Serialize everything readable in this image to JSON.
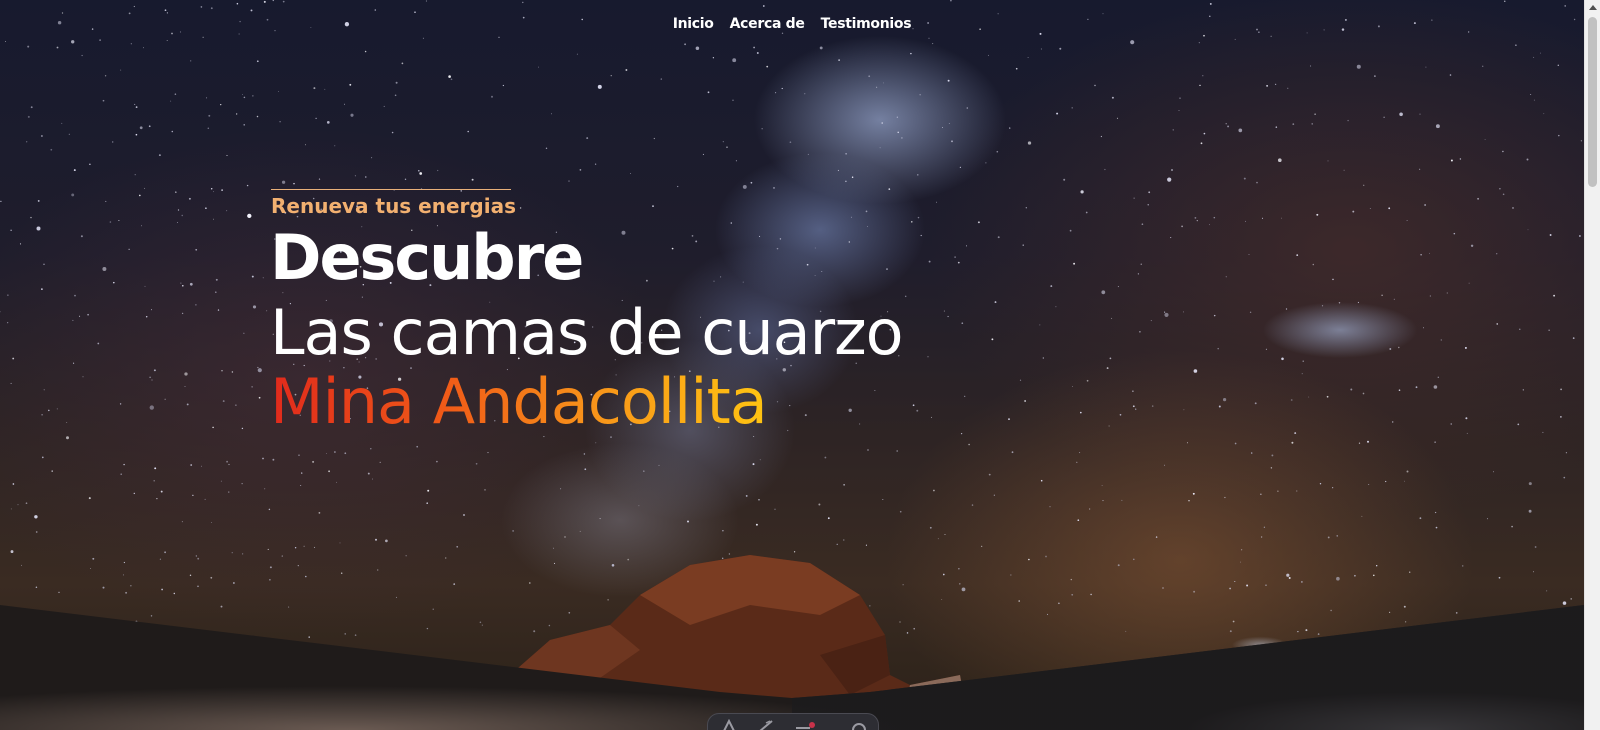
{
  "nav": {
    "items": [
      {
        "label": "Inicio"
      },
      {
        "label": "Acerca de"
      },
      {
        "label": "Testimonios"
      }
    ]
  },
  "hero": {
    "tagline": "Renueva tus energias",
    "title_line1": "Descubre",
    "title_line2": "Las camas de cuarzo",
    "title_line3": "Mina Andacollita"
  },
  "colors": {
    "tagline": "#f2b070",
    "title": "#ffffff",
    "gradient_start": "#e02a1c",
    "gradient_end": "#ffc412"
  },
  "dock": {
    "items": [
      {
        "icon": "text-icon"
      },
      {
        "icon": "pen-icon"
      },
      {
        "icon": "recording-icon"
      },
      {
        "icon": "gear-icon"
      }
    ]
  }
}
